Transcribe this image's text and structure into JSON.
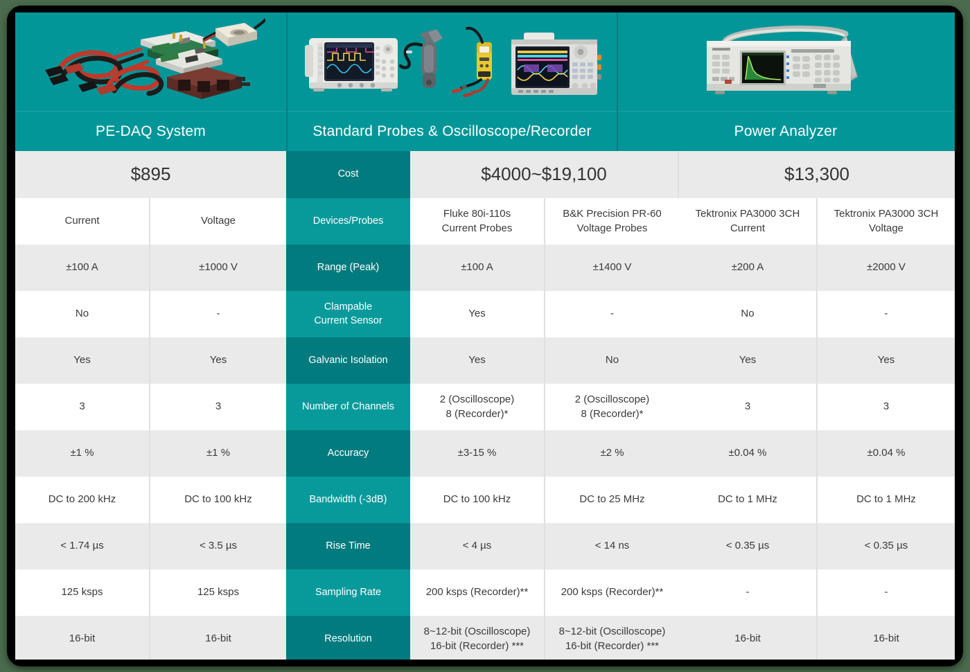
{
  "headers": [
    {
      "title": "PE-DAQ System",
      "art": "pe-daq-photo"
    },
    {
      "title": "Standard Probes & Oscilloscope/Recorder",
      "art": "probes-scope-photo"
    },
    {
      "title": "Power Analyzer",
      "art": "power-analyzer-photo"
    }
  ],
  "cost_row": {
    "label": "Cost",
    "pedaq": "$895",
    "standard": "$4000~$19,100",
    "power_analyzer": "$13,300"
  },
  "columns": {
    "pedaq_current": "Current",
    "pedaq_voltage": "Voltage",
    "std_current": "Fluke 80i-110s\nCurrent Probes",
    "std_voltage": "B&K Precision PR-60\nVoltage Probes",
    "pa_current": "Tektronix PA3000 3CH\nCurrent",
    "pa_voltage": "Tektronix PA3000 3CH\nVoltage"
  },
  "rows": [
    {
      "label": "Devices/Probes",
      "values": [
        "Current",
        "Voltage",
        "Fluke 80i-110s\nCurrent Probes",
        "B&K Precision PR-60\nVoltage Probes",
        "Tektronix PA3000 3CH\nCurrent",
        "Tektronix PA3000 3CH\nVoltage"
      ]
    },
    {
      "label": "Range (Peak)",
      "values": [
        "±100 A",
        "±1000 V",
        "±100 A",
        "±1400 V",
        "±200 A",
        "±2000 V"
      ]
    },
    {
      "label": "Clampable\nCurrent Sensor",
      "values": [
        "No",
        "-",
        "Yes",
        "-",
        "No",
        "-"
      ]
    },
    {
      "label": "Galvanic Isolation",
      "values": [
        "Yes",
        "Yes",
        "Yes",
        "No",
        "Yes",
        "Yes"
      ]
    },
    {
      "label": "Number of Channels",
      "values": [
        "3",
        "3",
        "2 (Oscilloscope)\n8 (Recorder)*",
        "2 (Oscilloscope)\n8 (Recorder)*",
        "3",
        "3"
      ]
    },
    {
      "label": "Accuracy",
      "values": [
        "±1 %",
        "±1 %",
        "±3-15 %",
        "±2 %",
        "±0.04 %",
        "±0.04 %"
      ]
    },
    {
      "label": "Bandwidth (-3dB)",
      "values": [
        "DC to 200 kHz",
        "DC to 100 kHz",
        "DC to 100 kHz",
        "DC to 25 MHz",
        "DC to 1 MHz",
        "DC to 1 MHz"
      ]
    },
    {
      "label": "Rise Time",
      "values": [
        "< 1.74 µs",
        "< 3.5 µs",
        "< 4 µs",
        "< 14 ns",
        "< 0.35 µs",
        "< 0.35 µs"
      ]
    },
    {
      "label": "Sampling Rate",
      "values": [
        "125 ksps",
        "125 ksps",
        "200 ksps (Recorder)**",
        "200 ksps (Recorder)**",
        "-",
        "-"
      ]
    },
    {
      "label": "Resolution",
      "values": [
        "16-bit",
        "16-bit",
        "8~12-bit (Oscilloscope)\n16-bit (Recorder) ***",
        "8~12-bit (Oscilloscope)\n16-bit (Recorder) ***",
        "16-bit",
        "16-bit"
      ]
    }
  ],
  "colors": {
    "teal_header": "#039698",
    "teal_label_dark": "#027b7e",
    "teal_label_light": "#089a9b",
    "row_shade": "#eaeaea",
    "row_plain": "#ffffff",
    "text": "#3a3a3a",
    "frame": "#000000",
    "page_background": "#4a6b4d"
  }
}
